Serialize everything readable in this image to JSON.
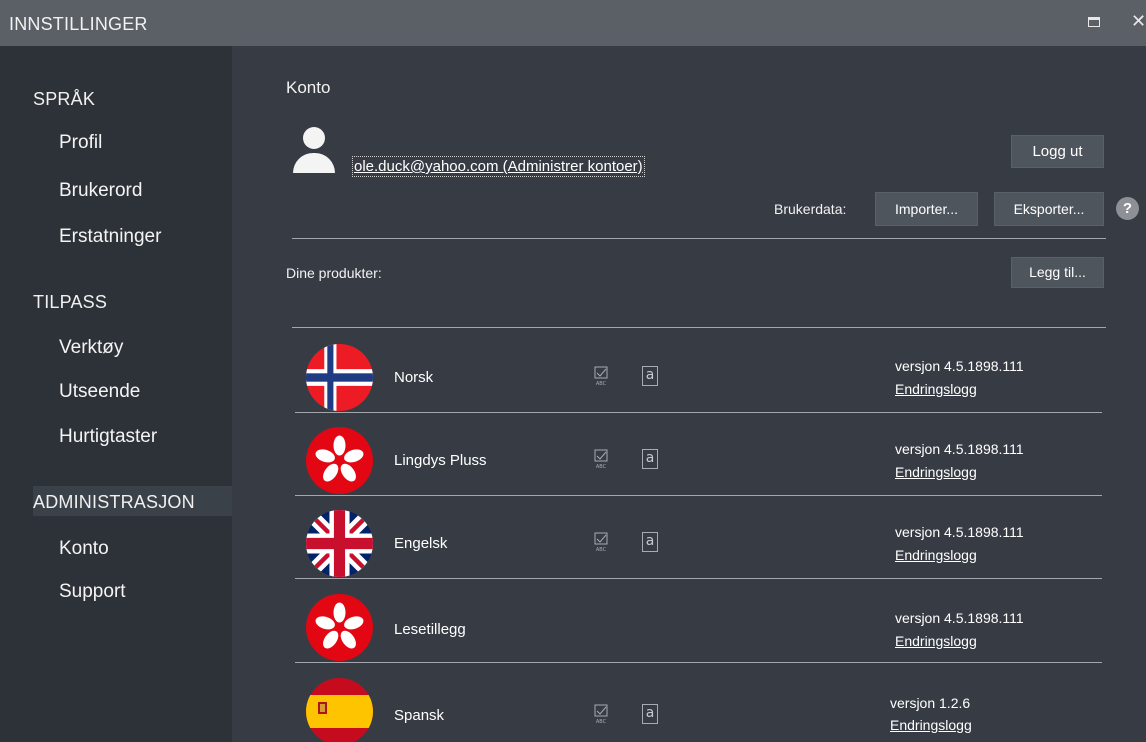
{
  "window": {
    "title": "INNSTILLINGER"
  },
  "sidebar": {
    "groups": [
      {
        "heading": "SPRÅK",
        "items": [
          "Profil",
          "Brukerord",
          "Erstatninger"
        ]
      },
      {
        "heading": "TILPASS",
        "items": [
          "Verktøy",
          "Utseende",
          "Hurtigtaster"
        ]
      },
      {
        "heading": "ADMINISTRASJON",
        "items": [
          "Konto",
          "Support"
        ]
      }
    ],
    "active_item": "Konto"
  },
  "account": {
    "heading": "Konto",
    "email_link": "ole.duck@yahoo.com (Administrer kontoer)",
    "logout_label": "Logg ut",
    "userdata_label": "Brukerdata:",
    "import_label": "Importer...",
    "export_label": "Eksporter...",
    "help_symbol": "?"
  },
  "products": {
    "heading": "Dine produkter:",
    "add_label": "Legg til...",
    "items": [
      {
        "name": "Norsk",
        "flag": "norway-flag-icon",
        "has_tools": true,
        "version": "versjon  4.5.1898.111",
        "changelog": "Endringslogg"
      },
      {
        "name": "Lingdys Pluss",
        "flag": "lingdys-logo-icon",
        "has_tools": true,
        "version": "versjon  4.5.1898.111",
        "changelog": "Endringslogg"
      },
      {
        "name": "Engelsk",
        "flag": "uk-flag-icon",
        "has_tools": true,
        "version": "versjon  4.5.1898.111",
        "changelog": "Endringslogg"
      },
      {
        "name": "Lesetillegg",
        "flag": "lingdys-logo-icon",
        "has_tools": false,
        "version": "versjon  4.5.1898.111",
        "changelog": "Endringslogg"
      },
      {
        "name": "Spansk",
        "flag": "spain-flag-icon",
        "has_tools": true,
        "version": "versjon  1.2.6",
        "changelog": "Endringslogg"
      }
    ]
  },
  "colors": {
    "titlebar": "#5b5f66",
    "sidebar": "#2d3238",
    "main": "#373c44",
    "button": "#4f555d",
    "flag_red": "#e30613"
  }
}
